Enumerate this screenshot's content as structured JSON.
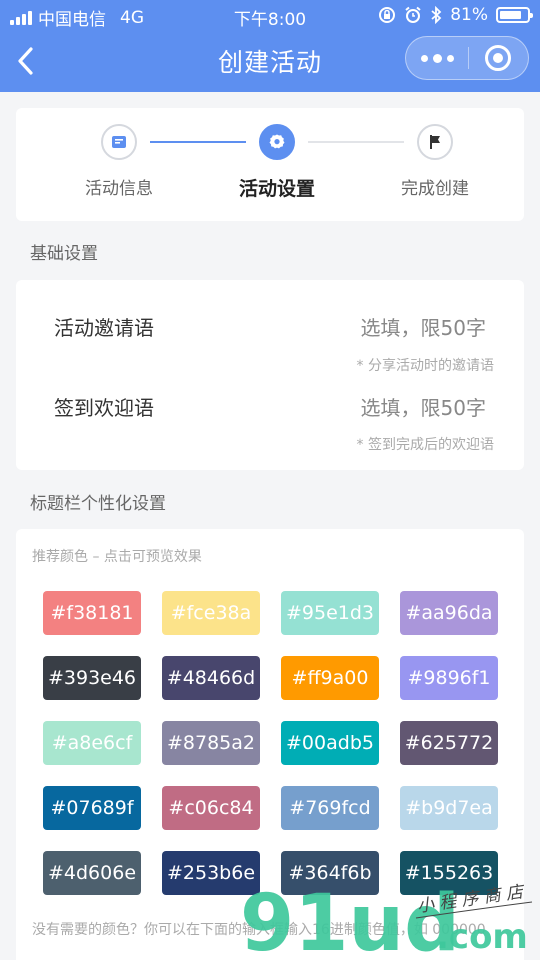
{
  "status": {
    "carrier": "中国电信",
    "network": "4G",
    "time": "下午8:00",
    "battery": "81%",
    "battery_level": 0.81
  },
  "nav": {
    "title": "创建活动"
  },
  "steps": [
    {
      "label": "活动信息",
      "icon": "doc-icon",
      "state": "done"
    },
    {
      "label": "活动设置",
      "icon": "gear-icon",
      "state": "active"
    },
    {
      "label": "完成创建",
      "icon": "flag-icon",
      "state": "pending"
    }
  ],
  "basic": {
    "section_title": "基础设置",
    "rows": [
      {
        "label": "活动邀请语",
        "placeholder": "选填，限50字",
        "hint": "* 分享活动时的邀请语"
      },
      {
        "label": "签到欢迎语",
        "placeholder": "选填，限50字",
        "hint": "* 签到完成后的欢迎语"
      }
    ]
  },
  "titlebar": {
    "section_title": "标题栏个性化设置",
    "hint": "推荐颜色 – 点击可预览效果",
    "colors": [
      "#f38181",
      "#fce38a",
      "#95e1d3",
      "#aa96da",
      "#393e46",
      "#48466d",
      "#ff9a00",
      "#9896f1",
      "#a8e6cf",
      "#8785a2",
      "#00adb5",
      "#625772",
      "#07689f",
      "#c06c84",
      "#769fcd",
      "#b9d7ea",
      "#4d606e",
      "#253b6e",
      "#364f6b",
      "#155263"
    ],
    "bottom_hint": "没有需要的颜色？你可以在下面的输入框输入16进制颜色值，如 000000"
  },
  "watermark": {
    "logo_text": "91ud.com",
    "script_text": "小程序商店"
  },
  "theme": {
    "accent": "#5d8ff0"
  }
}
